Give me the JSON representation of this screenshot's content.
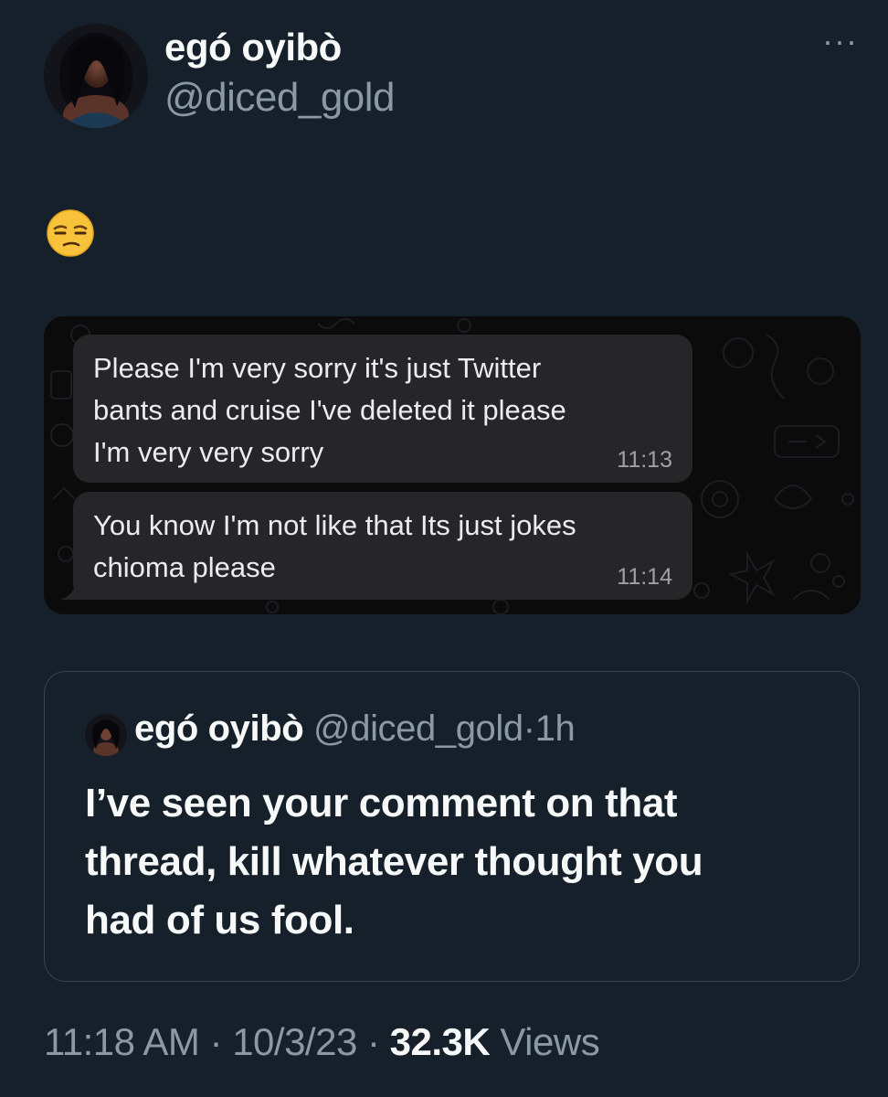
{
  "author": {
    "display_name": "egó oyibò",
    "handle": "@diced_gold",
    "avatar": "profile-photo"
  },
  "more_icon": "more-options-icon",
  "tweet": {
    "emoji": "unamused-face-emoji"
  },
  "media": {
    "messages": [
      {
        "lines": [
          "Please I'm very sorry it's just Twitter",
          "bants and cruise I've deleted it please",
          "I'm very very sorry"
        ],
        "time": "11:13"
      },
      {
        "lines": [
          "You know I'm not like that Its just jokes",
          "chioma please"
        ],
        "time": "11:14"
      }
    ],
    "colors": {
      "bubble": "#262628",
      "background": "#0b0b0c"
    }
  },
  "quote": {
    "display_name": "egó oyibò",
    "handle": "@diced_gold",
    "separator": "·",
    "time": "1h",
    "text_lines": [
      "I’ve seen your comment on that",
      "thread, kill whatever thought you",
      "had of us fool."
    ]
  },
  "meta": {
    "time": "11:18 AM",
    "date": "10/3/23",
    "views_count": "32.3K",
    "views_label": "Views",
    "separator": "·"
  },
  "colors": {
    "background": "#15202b",
    "text_primary": "#f7f9f9",
    "text_secondary": "#8b98a5",
    "border": "#38444d"
  }
}
